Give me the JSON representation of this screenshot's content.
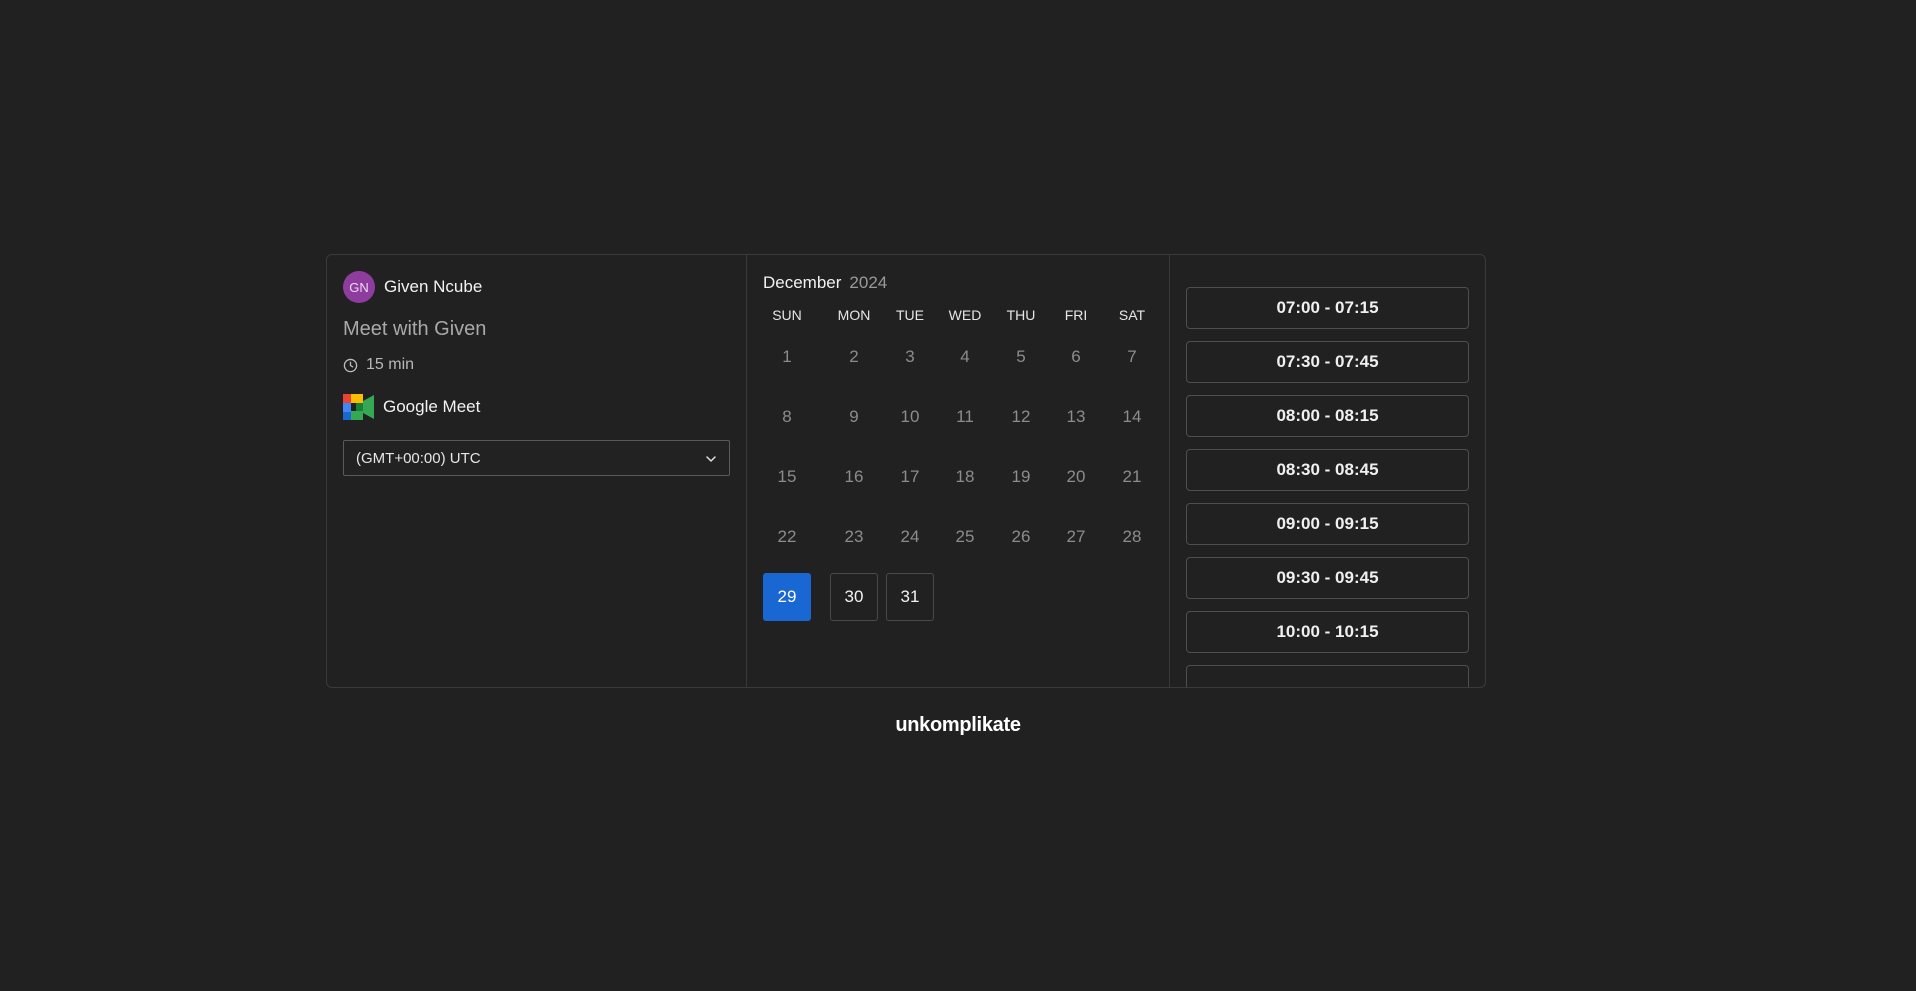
{
  "host": {
    "initials": "GN",
    "name": "Given Ncube"
  },
  "event": {
    "title": "Meet with Given",
    "duration": "15 min",
    "location": "Google Meet"
  },
  "timezone": {
    "value": "(GMT+00:00) UTC"
  },
  "calendar": {
    "month": "December",
    "year": "2024",
    "weekdays": [
      "SUN",
      "MON",
      "TUE",
      "WED",
      "THU",
      "FRI",
      "SAT"
    ],
    "days": [
      "1",
      "2",
      "3",
      "4",
      "5",
      "6",
      "7",
      "8",
      "9",
      "10",
      "11",
      "12",
      "13",
      "14",
      "15",
      "16",
      "17",
      "18",
      "19",
      "20",
      "21",
      "22",
      "23",
      "24",
      "25",
      "26",
      "27",
      "28",
      "29",
      "30",
      "31"
    ],
    "selected_day": "29",
    "available_days": [
      "29",
      "30",
      "31"
    ]
  },
  "slots": [
    "07:00 - 07:15",
    "07:30 - 07:45",
    "08:00 - 08:15",
    "08:30 - 08:45",
    "09:00 - 09:15",
    "09:30 - 09:45",
    "10:00 - 10:15"
  ],
  "brand": {
    "name": "unkomplikate"
  },
  "colors": {
    "accent": "#1967d2",
    "avatar": "#8e3d9e",
    "background": "#212121"
  }
}
